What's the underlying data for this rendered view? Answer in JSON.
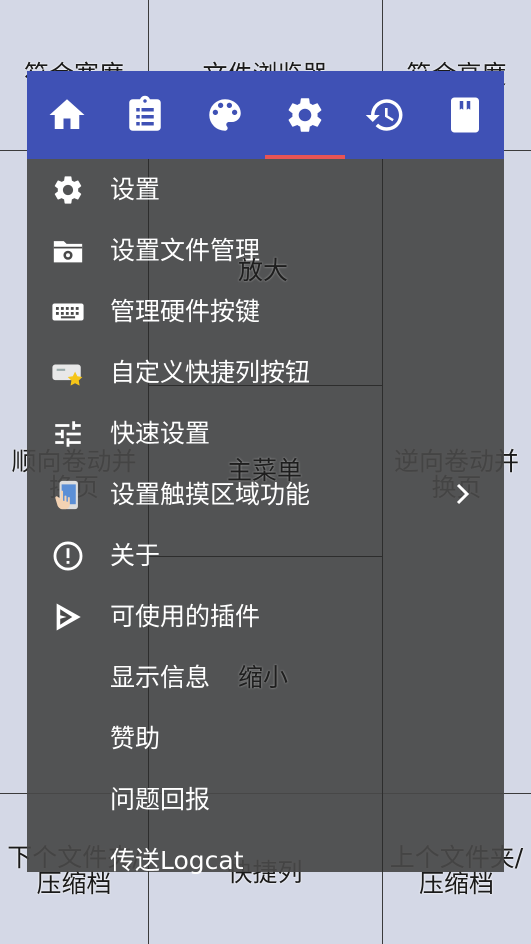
{
  "zones": {
    "top_left": "符合宽度",
    "top_center": "文件浏览器",
    "top_right": "符合高度",
    "zoom_in": "放大",
    "left_1": "顺向卷动并",
    "left_2": "换页",
    "center": "主菜单",
    "right_1": "逆向卷动并",
    "right_2": "换页",
    "zoom_out": "缩小",
    "bottom_left_1": "下个文件夹/",
    "bottom_left_2": "压缩档",
    "bottom_center": "快捷列",
    "bottom_right_1": "上个文件夹/",
    "bottom_right_2": "压缩档"
  },
  "tabs": [
    {
      "name": "home",
      "icon": "home-icon"
    },
    {
      "name": "clipboard",
      "icon": "clipboard-icon"
    },
    {
      "name": "palette",
      "icon": "palette-icon"
    },
    {
      "name": "settings",
      "icon": "gear-icon",
      "selected": true
    },
    {
      "name": "history",
      "icon": "history-icon"
    },
    {
      "name": "bookmark",
      "icon": "bookmark-icon"
    }
  ],
  "menu": {
    "items": [
      {
        "label": "设置",
        "icon": "gear-icon"
      },
      {
        "label": "设置文件管理",
        "icon": "settings-folder-icon"
      },
      {
        "label": "管理硬件按键",
        "icon": "keyboard-icon"
      },
      {
        "label": "自定义快捷列按钮",
        "icon": "custom-button-icon"
      },
      {
        "label": "快速设置",
        "icon": "tune-icon"
      },
      {
        "label": "设置触摸区域功能",
        "icon": "touch-phone-icon"
      },
      {
        "label": "关于",
        "icon": "info-icon"
      },
      {
        "label": "可使用的插件",
        "icon": "play-plugin-icon"
      },
      {
        "label": "显示信息",
        "icon": ""
      },
      {
        "label": "赞助",
        "icon": ""
      },
      {
        "label": "问题回报",
        "icon": ""
      },
      {
        "label": "传送Logcat",
        "icon": ""
      }
    ]
  },
  "colors": {
    "topbar": "#3f51b5",
    "indicator": "#e85454",
    "panel": "#484848",
    "background": "#d4d8e6"
  }
}
